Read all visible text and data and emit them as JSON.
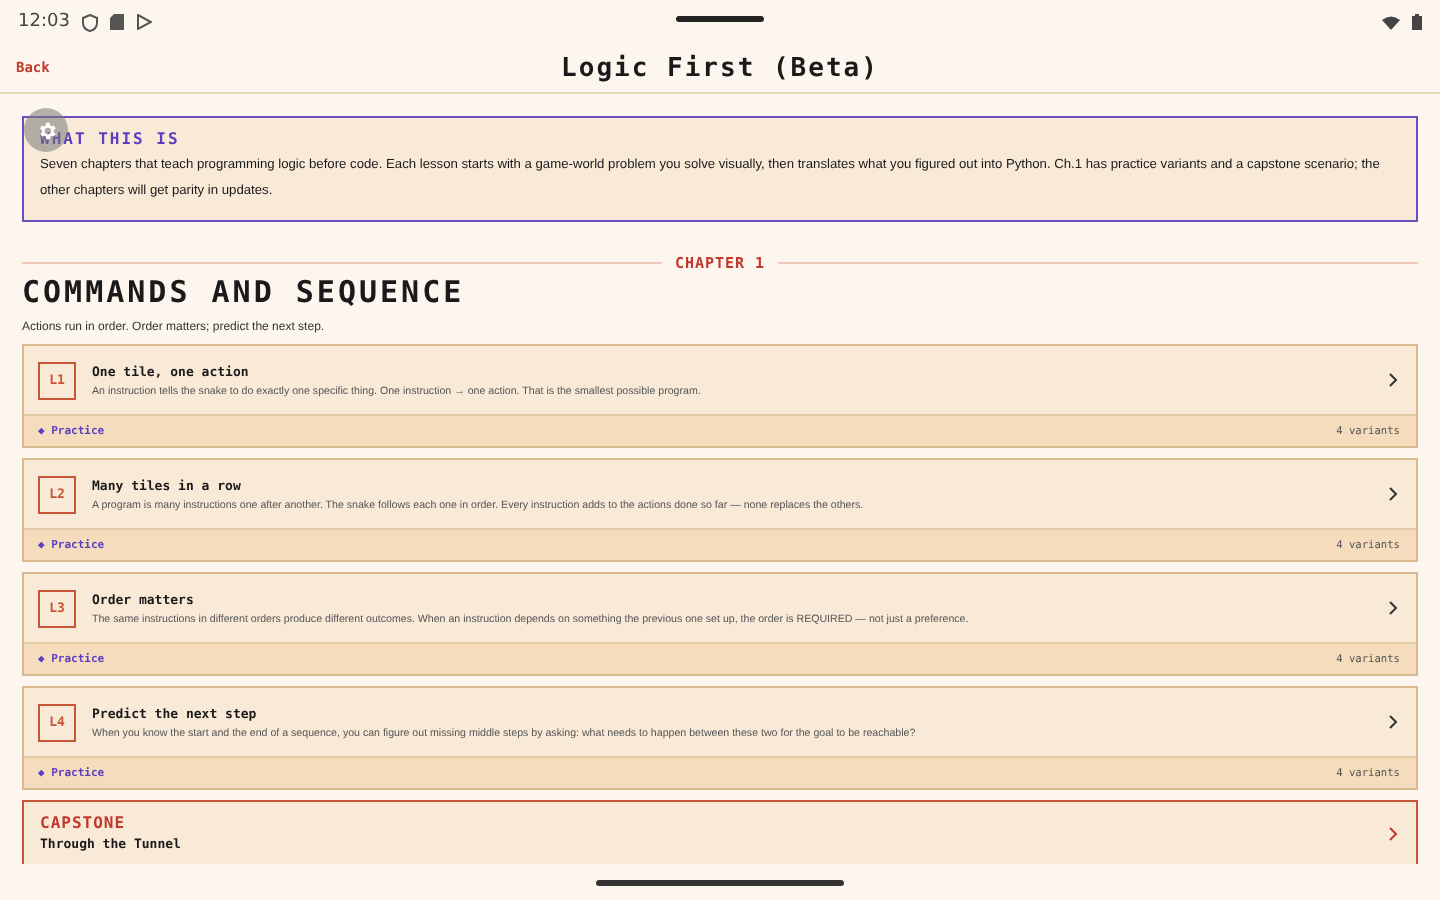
{
  "status_bar": {
    "time": "12:03"
  },
  "header": {
    "back": "Back",
    "title": "Logic First (Beta)"
  },
  "info": {
    "heading": "WHAT THIS IS",
    "text": "Seven chapters that teach programming logic before code. Each lesson starts with a game-world problem you solve visually, then translates what you figured out into Python. Ch.1 has practice variants and a capstone scenario; the other chapters will get parity in updates."
  },
  "chapter": {
    "label": "CHAPTER 1",
    "title": "COMMANDS AND SEQUENCE",
    "subtitle": "Actions run in order. Order matters; predict the next step."
  },
  "lessons": [
    {
      "badge": "L1",
      "title": "One tile, one action",
      "description": "An instruction tells the snake to do exactly one specific thing. One instruction → one action. That is the smallest possible program.",
      "practice": "◆ Practice",
      "variants": "4 variants"
    },
    {
      "badge": "L2",
      "title": "Many tiles in a row",
      "description": "A program is many instructions one after another. The snake follows each one in order. Every instruction adds to the actions done so far — none replaces the others.",
      "practice": "◆ Practice",
      "variants": "4 variants"
    },
    {
      "badge": "L3",
      "title": "Order matters",
      "description": "The same instructions in different orders produce different outcomes. When an instruction depends on something the previous one set up, the order is REQUIRED — not just a preference.",
      "practice": "◆ Practice",
      "variants": "4 variants"
    },
    {
      "badge": "L4",
      "title": "Predict the next step",
      "description": "When you know the start and the end of a sequence, you can figure out missing middle steps by asking: what needs to happen between these two for the goal to be reachable?",
      "practice": "◆ Practice",
      "variants": "4 variants"
    }
  ],
  "capstone": {
    "label": "CAPSTONE",
    "title": "Through the Tunnel"
  }
}
